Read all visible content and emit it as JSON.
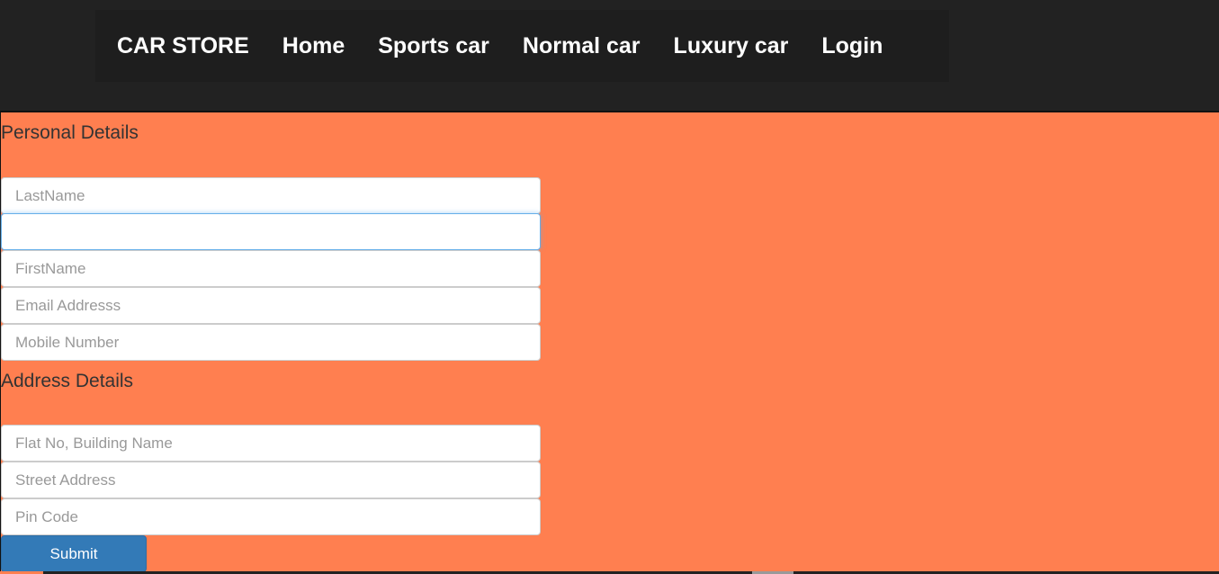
{
  "nav": {
    "brand": "CAR STORE",
    "links": [
      "Home",
      "Sports car",
      "Normal car",
      "Luxury car",
      "Login"
    ]
  },
  "personal": {
    "title": "Personal Details",
    "fields": [
      {
        "placeholder": "LastName",
        "value": ""
      },
      {
        "placeholder": "",
        "value": ""
      },
      {
        "placeholder": "FirstName",
        "value": ""
      },
      {
        "placeholder": "Email Addresss",
        "value": ""
      },
      {
        "placeholder": "Mobile Number",
        "value": ""
      }
    ]
  },
  "address": {
    "title": "Address Details",
    "fields": [
      {
        "placeholder": "Flat No, Building Name",
        "value": ""
      },
      {
        "placeholder": "Street Address",
        "value": ""
      },
      {
        "placeholder": "Pin Code",
        "value": ""
      }
    ]
  },
  "submit_label": "Submit",
  "colors": {
    "nav_bg": "#222222",
    "page_bg": "#ff7f50",
    "button": "#337ab7"
  }
}
